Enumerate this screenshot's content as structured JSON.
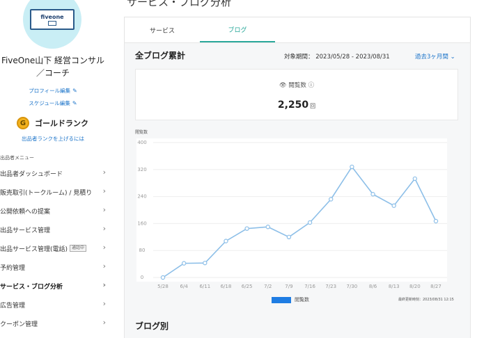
{
  "page": {
    "title": "サービス・ブログ分析"
  },
  "profile": {
    "logo_text": "fiveone",
    "name_line1": "FiveOne山下 経営コンサル",
    "name_line2": "／コーチ",
    "profile_edit": "プロフィール編集",
    "schedule_edit": "スケジュール編集",
    "rank_icon": "G",
    "rank_label": "ゴールドランク",
    "rank_help": "出品者ランクを上げるには"
  },
  "sidebar": {
    "menu_heading": "出品者メニュー",
    "items": [
      {
        "label": "出品者ダッシュボード"
      },
      {
        "label": "販売取引(トークルーム) / 見積り"
      },
      {
        "label": "公開依頼への提案"
      },
      {
        "label": "出品サービス管理"
      },
      {
        "label": "出品サービス管理(電話)",
        "badge": "通話中"
      },
      {
        "label": "予約管理"
      },
      {
        "label": "サービス・ブログ分析"
      },
      {
        "label": "広告管理"
      },
      {
        "label": "クーポン管理"
      }
    ]
  },
  "tabs": [
    {
      "label": "サービス"
    },
    {
      "label": "ブログ"
    }
  ],
  "summary": {
    "section_title": "全ブログ累計",
    "period_label": "対象期間：",
    "period_range": "2023/05/28 - 2023/08/31",
    "period_select": "過去3ヶ月間",
    "stat_label": "閲覧数",
    "stat_value": "2,250",
    "stat_unit": "回"
  },
  "chart_data": {
    "type": "line",
    "ylabel": "閲覧数",
    "ylim": [
      0,
      400
    ],
    "yticks": [
      0,
      80,
      160,
      240,
      320,
      400
    ],
    "categories": [
      "5/28",
      "6/4",
      "6/11",
      "6/18",
      "6/25",
      "7/2",
      "7/9",
      "7/16",
      "7/23",
      "7/30",
      "8/6",
      "8/13",
      "8/20",
      "8/27"
    ],
    "series": [
      {
        "name": "閲覧数",
        "color": "#8dbfe8",
        "values": [
          0,
          42,
          43,
          108,
          145,
          150,
          120,
          163,
          232,
          328,
          247,
          213,
          293,
          167
        ]
      }
    ],
    "grid": true,
    "legend": "bottom-center",
    "updated_text": "最終更新時刻：2023/08/31 12:15"
  },
  "blog_section": {
    "title": "ブログ別"
  },
  "colors": {
    "accent": "#2aa89a",
    "link": "#1a73c9",
    "line": "#8dbfe8",
    "legend": "#1f7de3"
  }
}
